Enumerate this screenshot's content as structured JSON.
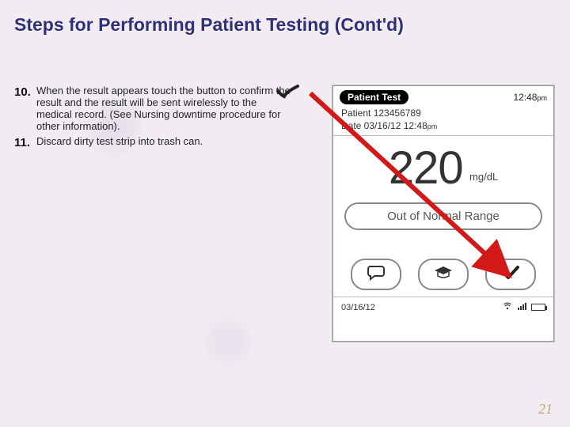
{
  "title": "Steps for Performing Patient Testing  (Cont'd)",
  "steps": [
    {
      "num": "10.",
      "text": "When the result appears touch the button to confirm the result and the result will be sent wirelessly to the medical record.  (See Nursing downtime procedure for other information)."
    },
    {
      "num": "11.",
      "text": "Discard dirty test strip into trash can."
    }
  ],
  "device": {
    "header_pill": "Patient Test",
    "clock_time": "12:48",
    "clock_ampm": "pm",
    "patient_line": "Patient 123456789",
    "date_line_prefix": "Date 03/16/12 12:48",
    "date_line_ampm": "pm",
    "result_value": "220",
    "result_unit": "mg/dL",
    "range_label": "Out of Normal Range",
    "footer_date": "03/16/12"
  },
  "page_number": "21"
}
